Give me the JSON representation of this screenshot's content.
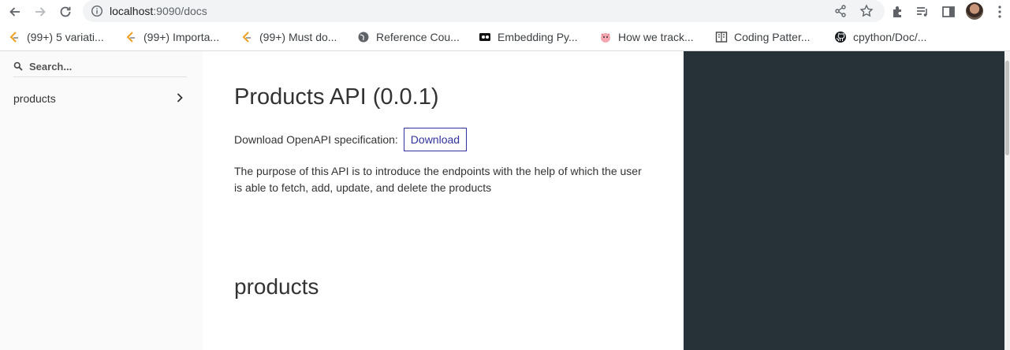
{
  "browser": {
    "url_host": "localhost",
    "url_rest": ":9090/docs"
  },
  "bookmarks": [
    {
      "label": "(99+) 5 variati...",
      "icon": "leetcode-icon"
    },
    {
      "label": "(99+) Importa...",
      "icon": "leetcode-icon"
    },
    {
      "label": "(99+) Must do...",
      "icon": "leetcode-icon"
    },
    {
      "label": "Reference Cou...",
      "icon": "globe-icon"
    },
    {
      "label": "Embedding Py...",
      "icon": "media-icon"
    },
    {
      "label": "How we track...",
      "icon": "pig-icon"
    },
    {
      "label": "Coding Patter...",
      "icon": "book-icon"
    },
    {
      "label": "cpython/Doc/...",
      "icon": "github-icon"
    }
  ],
  "sidebar": {
    "search_placeholder": "Search...",
    "items": [
      {
        "label": "products"
      }
    ]
  },
  "main": {
    "title": "Products API (0.0.1)",
    "download_label": "Download OpenAPI specification:",
    "download_button": "Download",
    "description": "The purpose of this API is to introduce the endpoints with the help of which the user is able to fetch, add, update, and delete the products",
    "section_title": "products"
  },
  "colors": {
    "accent": "#32329f",
    "right_panel": "#263238",
    "sidebar_bg": "#fafafa"
  }
}
